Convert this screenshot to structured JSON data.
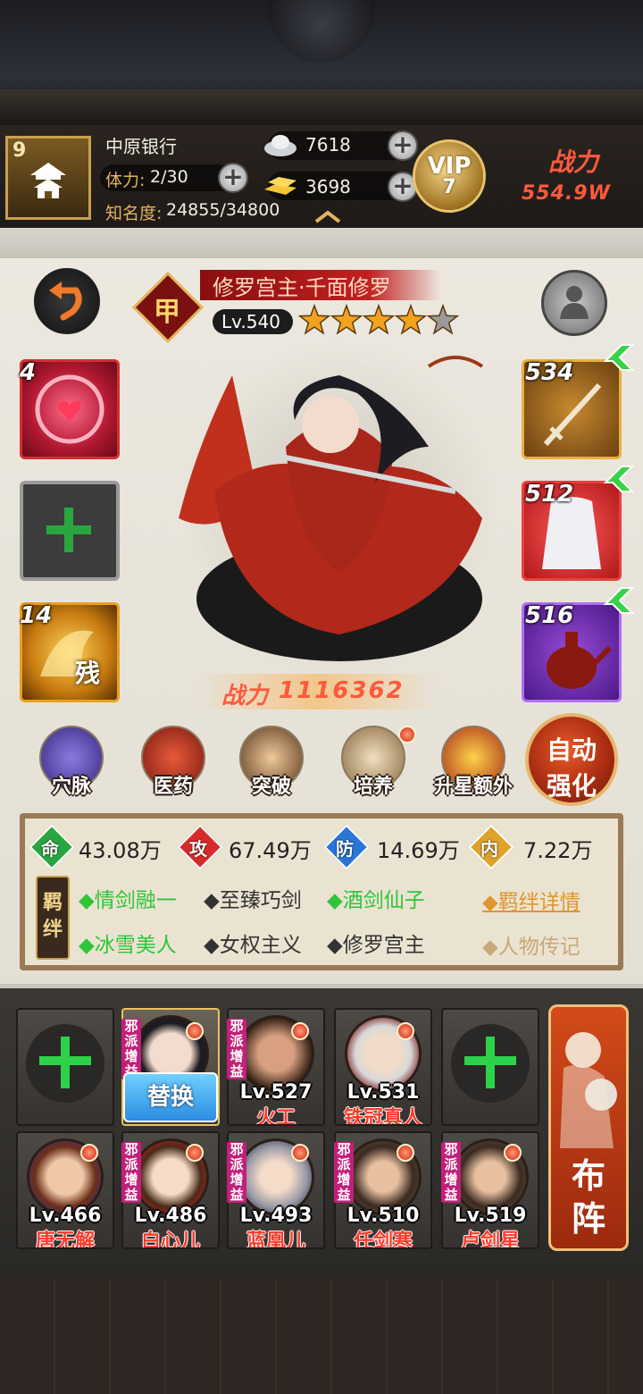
{
  "player": {
    "rank": "9",
    "name": "中原银行",
    "stamina_label": "体力:",
    "stamina": "2/30",
    "fame_label": "知名度:",
    "fame": "24855/34800",
    "silver": "7618",
    "gold": "3698",
    "vip_text": "VIP",
    "vip_level": "7",
    "power_label": "战力",
    "power": "554.9W"
  },
  "hero": {
    "title": "修罗宫主·千面修罗",
    "rarity_mark": "甲",
    "level": "Lv.540",
    "stars": 4,
    "max_stars": 5,
    "power_label": "战力",
    "power": "1116362"
  },
  "left_slots": [
    {
      "count": "4"
    },
    {
      "count": ""
    },
    {
      "count": "14",
      "mark": "残"
    }
  ],
  "equipment": [
    {
      "level": "534"
    },
    {
      "level": "512"
    },
    {
      "level": "516"
    }
  ],
  "skills": [
    {
      "label": "穴脉"
    },
    {
      "label": "医药"
    },
    {
      "label": "突破"
    },
    {
      "label": "培养"
    },
    {
      "label": "升星额外"
    }
  ],
  "auto_button": {
    "line1": "自动",
    "line2": "强化"
  },
  "stats": [
    {
      "key": "命",
      "value": "43.08万",
      "color": "#2aa640"
    },
    {
      "key": "攻",
      "value": "67.49万",
      "color": "#d82a2a"
    },
    {
      "key": "防",
      "value": "14.69万",
      "color": "#2a76d8"
    },
    {
      "key": "内",
      "value": "7.22万",
      "color": "#e0a22a"
    }
  ],
  "bonds": {
    "tag_line1": "羁",
    "tag_line2": "绊",
    "row1": [
      "◆情剑融一",
      "◆至臻巧剑",
      "◆酒剑仙子"
    ],
    "row2": [
      "◆冰雪美人",
      "◆女权主义",
      "◆修罗宫主"
    ],
    "detail_link": "◆羁绊详情",
    "bio_link": "◆人物传记"
  },
  "team": {
    "tag": "邪派增益",
    "swap_label": "替换",
    "plus": "十",
    "row1": [
      {
        "level": "Lv.527",
        "name": "火工"
      },
      {
        "level": "Lv.531",
        "name": "铁冠真人"
      }
    ],
    "row2": [
      {
        "level": "Lv.466",
        "name": "唐无解"
      },
      {
        "level": "Lv.486",
        "name": "白心儿"
      },
      {
        "level": "Lv.493",
        "name": "蓝凰儿"
      },
      {
        "level": "Lv.510",
        "name": "任剑寒"
      },
      {
        "level": "Lv.519",
        "name": "卢剑星"
      }
    ],
    "formation_line1": "布",
    "formation_line2": "阵"
  },
  "colors": {
    "accent_gold": "#e3b45a",
    "power_red": "#ff5a3c",
    "bond_green": "#2ec53a"
  }
}
